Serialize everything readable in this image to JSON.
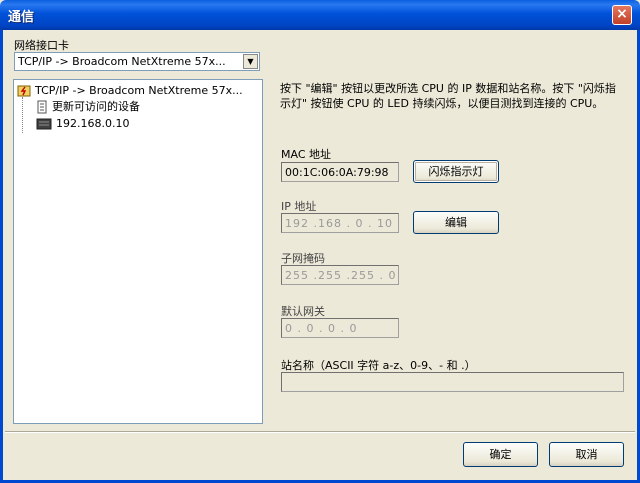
{
  "window": {
    "title": "通信",
    "close_glyph": "×"
  },
  "adapter": {
    "label": "网络接口卡",
    "selected": "TCP/IP -> Broadcom NetXtreme 57x..."
  },
  "tree": {
    "items": [
      {
        "label": "TCP/IP -> Broadcom NetXtreme 57x...",
        "icon": "network-adapter-icon"
      },
      {
        "label": "更新可访问的设备",
        "icon": "refresh-devices-icon"
      },
      {
        "label": "192.168.0.10",
        "icon": "device-icon"
      }
    ]
  },
  "description": "按下 \"编辑\" 按钮以更改所选 CPU 的 IP 数据和站名称。按下 \"闪烁指示灯\" 按钮使 CPU 的 LED 持续闪烁，以便目测找到连接的 CPU。",
  "mac": {
    "label": "MAC 地址",
    "value": "00:1C:06:0A:79:98"
  },
  "flash_button": "闪烁指示灯",
  "ip": {
    "label": "IP 地址",
    "value": "192 .168 . 0 . 10"
  },
  "edit_button": "编辑",
  "subnet": {
    "label": "子网掩码",
    "value": "255 .255 .255 . 0"
  },
  "gateway": {
    "label": "默认网关",
    "value": "0 . 0 . 0 . 0"
  },
  "station": {
    "label": "站名称（ASCII 字符 a-z、0-9、- 和 .）",
    "value": ""
  },
  "ok_button": "确定",
  "cancel_button": "取消",
  "colors": {
    "titlebar": "#0052d9",
    "dialog_bg": "#ece9d8",
    "close": "#c24128"
  }
}
